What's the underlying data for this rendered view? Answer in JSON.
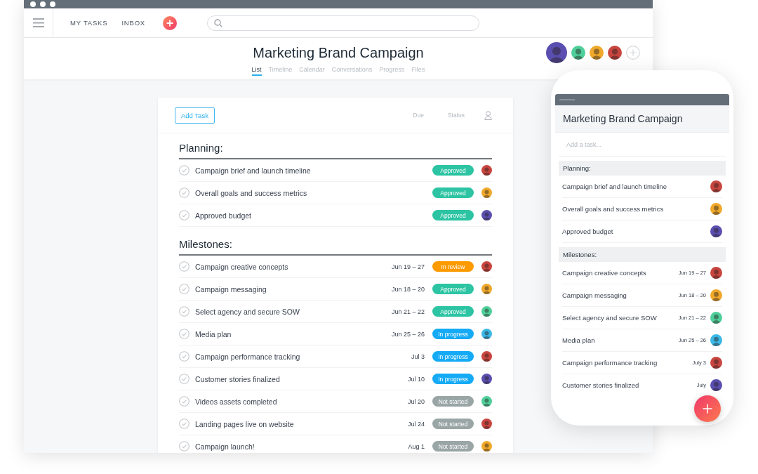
{
  "nav": [
    {
      "label": "MY TASKS"
    },
    {
      "label": "INBOX"
    }
  ],
  "project": {
    "title": "Marketing Brand Campaign",
    "tabs": [
      {
        "label": "List",
        "selected": true
      },
      {
        "label": "Timeline",
        "selected": false
      },
      {
        "label": "Calendar",
        "selected": false
      },
      {
        "label": "Conversations",
        "selected": false
      },
      {
        "label": "Progress",
        "selected": false
      },
      {
        "label": "Files",
        "selected": false
      }
    ],
    "members": [
      {
        "color": "#5a4fb0"
      },
      {
        "color": "#4fcf9a"
      },
      {
        "color": "#f0a92a"
      },
      {
        "color": "#c9453f"
      }
    ]
  },
  "task_list": {
    "add_button": "Add Task",
    "columns": [
      "Due",
      "Status"
    ],
    "sections": [
      {
        "title": "Planning:",
        "tasks": [
          {
            "name": "Campaign brief and launch timeline",
            "status": "Approved",
            "color": "#2cc4a3",
            "avatar": {
              "color": "#c9453f"
            }
          },
          {
            "name": "Overall goals and success metrics",
            "status": "Approved",
            "color": "#2cc4a3",
            "avatar": {
              "color": "#f0a92a"
            }
          },
          {
            "name": "Approved budget",
            "status": "Approved",
            "color": "#2cc4a3",
            "avatar": {
              "color": "#5a4fb0"
            }
          }
        ]
      },
      {
        "title": "Milestones:",
        "tasks": [
          {
            "name": "Campaign creative concepts",
            "due": "Jun 19 – 27",
            "status": "In review",
            "color": "#fd9a00",
            "avatar": {
              "color": "#c9453f"
            }
          },
          {
            "name": "Campaign messaging",
            "due": "Jun 18 – 20",
            "status": "Approved",
            "color": "#2cc4a3",
            "avatar": {
              "color": "#f0a92a"
            }
          },
          {
            "name": "Select agency and secure SOW",
            "due": "Jun 21 – 22",
            "status": "Approved",
            "color": "#2cc4a3",
            "avatar": {
              "color": "#4fcf9a"
            }
          },
          {
            "name": "Media plan",
            "due": "Jun 25 – 26",
            "status": "In progress",
            "color": "#14aaf5",
            "avatar": {
              "color": "#3ab8e6"
            }
          },
          {
            "name": "Campaign performance tracking",
            "due": "Jul 3",
            "status": "In progress",
            "color": "#14aaf5",
            "avatar": {
              "color": "#c9453f"
            }
          },
          {
            "name": "Customer stories finalized",
            "due": "Jul 10",
            "status": "In progress",
            "color": "#14aaf5",
            "avatar": {
              "color": "#5a4fb0"
            }
          },
          {
            "name": "Videos assets completed",
            "due": "Jul 20",
            "status": "Not started",
            "color": "#9aa6a6",
            "avatar": {
              "color": "#4fcf9a"
            }
          },
          {
            "name": "Landing pages live on website",
            "due": "Jul 24",
            "status": "Not started",
            "color": "#9aa6a6",
            "avatar": {
              "color": "#c9453f"
            }
          },
          {
            "name": "Campaign launch!",
            "due": "Aug 1",
            "status": "Not started",
            "color": "#9aa6a6",
            "avatar": {
              "color": "#f0a92a"
            }
          }
        ]
      }
    ]
  },
  "mobile": {
    "title": "Marketing Brand Campaign",
    "placeholder": "Add a task...",
    "sections": [
      {
        "title": "Planning:",
        "tasks": [
          {
            "name": "Campaign brief and launch timeline",
            "color": "#c9453f"
          },
          {
            "name": "Overall goals and success metrics",
            "color": "#f0a92a"
          },
          {
            "name": "Approved budget",
            "color": "#5a4fb0"
          }
        ]
      },
      {
        "title": "Milestones:",
        "tasks": [
          {
            "name": "Campaign creative concepts",
            "due": "Jun 19 – 27",
            "color": "#c9453f"
          },
          {
            "name": "Campaign messaging",
            "due": "Jun 18 – 20",
            "color": "#f0a92a"
          },
          {
            "name": "Select agency and secure SOW",
            "due": "Jun 21 – 22",
            "color": "#4fcf9a"
          },
          {
            "name": "Media plan",
            "due": "Jun 25 – 26",
            "color": "#3ab8e6"
          },
          {
            "name": "Campaign performance tracking",
            "due": "July 3",
            "color": "#c9453f"
          },
          {
            "name": "Customer stories finalized",
            "due": "July",
            "color": "#5a4fb0"
          }
        ]
      }
    ]
  }
}
